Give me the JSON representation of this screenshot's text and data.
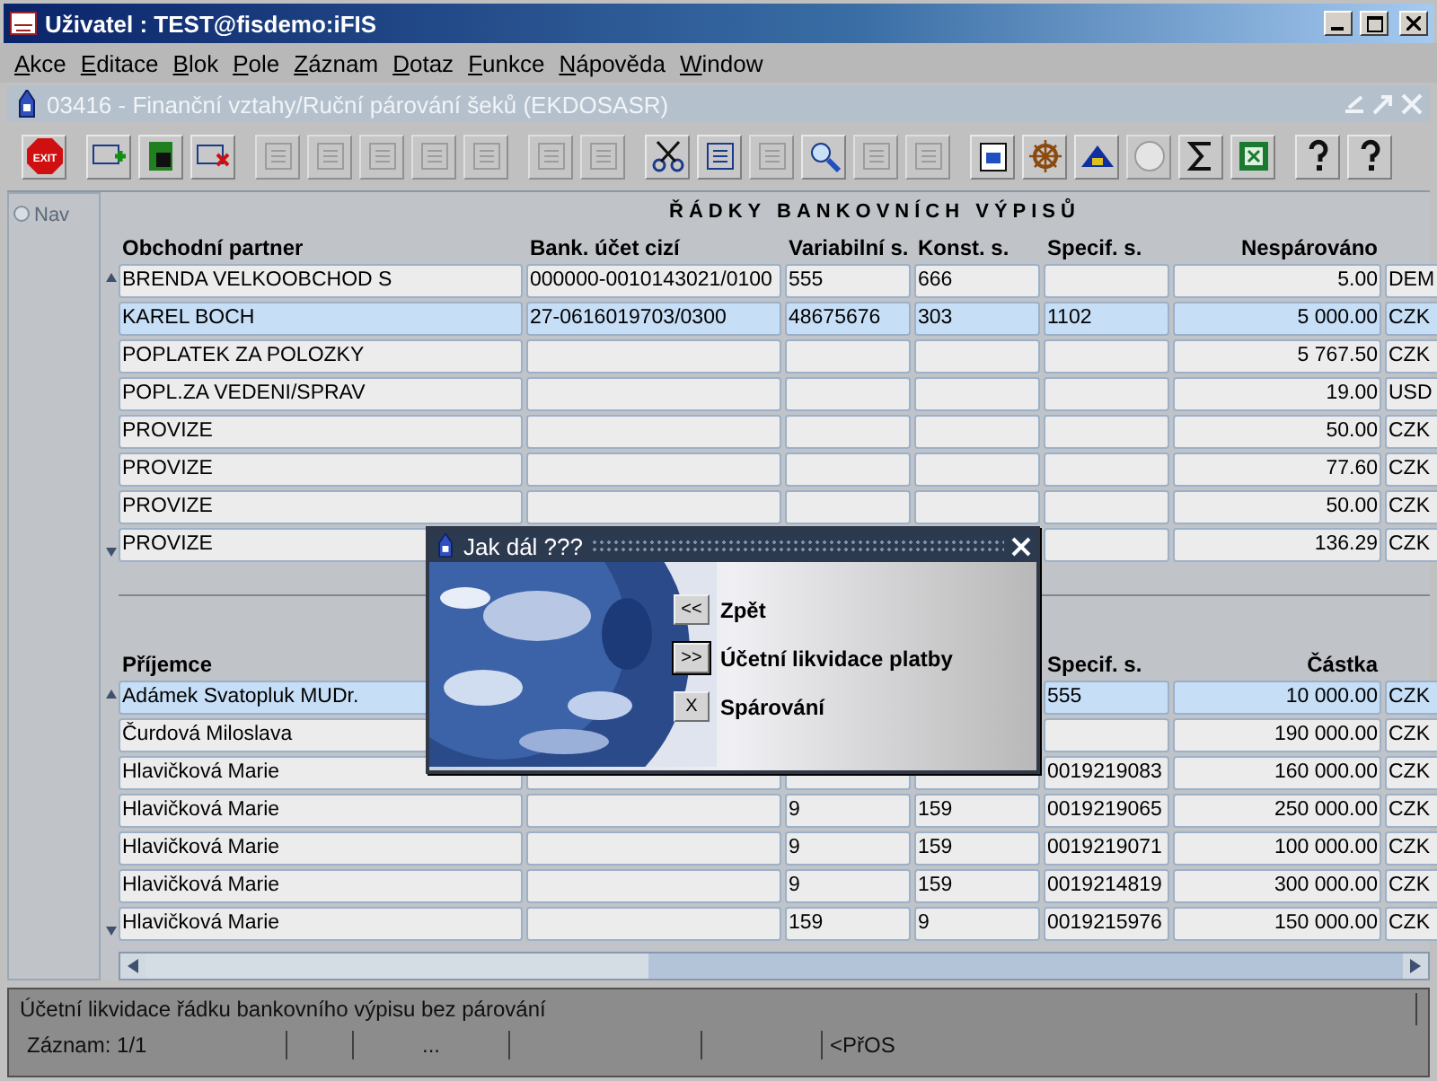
{
  "window": {
    "title": "Uživatel : TEST@fisdemo:iFIS"
  },
  "menu": [
    "Akce",
    "Editace",
    "Blok",
    "Pole",
    "Záznam",
    "Dotaz",
    "Funkce",
    "Nápověda",
    "Window"
  ],
  "form": {
    "title": "03416 - Finanční vztahy/Ruční párování šeků (EKDOSASR)"
  },
  "toolbar": [
    {
      "label": "EXIT",
      "disabled": false
    },
    {
      "disabled": false
    },
    {
      "disabled": false
    },
    {
      "disabled": false
    },
    {
      "disabled": true
    },
    {
      "disabled": true
    },
    {
      "disabled": true
    },
    {
      "disabled": true
    },
    {
      "disabled": true
    },
    {
      "disabled": true
    },
    {
      "disabled": true
    },
    {
      "disabled": false
    },
    {
      "disabled": false
    },
    {
      "disabled": true
    },
    {
      "disabled": false
    },
    {
      "disabled": true
    },
    {
      "disabled": true
    },
    {
      "disabled": false
    },
    {
      "disabled": false
    },
    {
      "disabled": false
    },
    {
      "disabled": true
    },
    {
      "disabled": false
    },
    {
      "disabled": false
    },
    {
      "disabled": false
    },
    {
      "disabled": false
    }
  ],
  "nav": {
    "label": "Nav"
  },
  "bank_lines": {
    "title": "ŘÁDKY BANKOVNÍCH VÝPISŮ",
    "columns": {
      "partner": "Obchodní partner",
      "account": "Bank. účet cizí",
      "var": "Variabilní s.",
      "const": "Konst. s.",
      "spec": "Specif. s.",
      "amount": "Nespárováno"
    },
    "rows": [
      {
        "partner": "BRENDA VELKOOBCHOD S",
        "account": "000000-0010143021/0100",
        "var": "555",
        "const": "666",
        "amount": "5.00",
        "currency": "DEM",
        "selected": false
      },
      {
        "partner": "KAREL BOCH",
        "account": "27-0616019703/0300",
        "var": "48675676",
        "const": "303",
        "spec": "1102",
        "amount": "5 000.00",
        "currency": "CZK",
        "selected": true
      },
      {
        "partner": "POPLATEK ZA POLOZKY",
        "amount": "5 767.50",
        "currency": "CZK",
        "selected": false
      },
      {
        "partner": "POPL.ZA VEDENI/SPRAV",
        "amount": "19.00",
        "currency": "USD",
        "selected": false
      },
      {
        "partner": "PROVIZE",
        "amount": "50.00",
        "currency": "CZK",
        "selected": false
      },
      {
        "partner": "PROVIZE",
        "amount": "77.60",
        "currency": "CZK",
        "selected": false
      },
      {
        "partner": "PROVIZE",
        "amount": "50.00",
        "currency": "CZK",
        "selected": false
      },
      {
        "partner": "PROVIZE",
        "amount": "136.29",
        "currency": "CZK",
        "selected": false
      }
    ]
  },
  "payments": {
    "columns": {
      "partner": "Příjemce",
      "spec": "Specif. s.",
      "amount": "Částka"
    },
    "rows": [
      {
        "partner": "Adámek Svatopluk MUDr.",
        "spec": "555",
        "amount": "10 000.00",
        "currency": "CZK",
        "selected": true
      },
      {
        "partner": "Čurdová Miloslava",
        "amount": "190 000.00",
        "currency": "CZK",
        "selected": false
      },
      {
        "partner": "Hlavičková Marie",
        "spec": "0019219083",
        "amount": "160 000.00",
        "currency": "CZK",
        "selected": false
      },
      {
        "partner": "Hlavičková Marie",
        "var": "9",
        "const": "159",
        "spec": "0019219065",
        "amount": "250 000.00",
        "currency": "CZK",
        "selected": false
      },
      {
        "partner": "Hlavičková Marie",
        "var": "9",
        "const": "159",
        "spec": "0019219071",
        "amount": "100 000.00",
        "currency": "CZK",
        "selected": false
      },
      {
        "partner": "Hlavičková Marie",
        "var": "9",
        "const": "159",
        "spec": "0019214819",
        "amount": "300 000.00",
        "currency": "CZK",
        "selected": false
      },
      {
        "partner": "Hlavičková Marie",
        "var": "159",
        "const": "9",
        "spec": "0019215976",
        "amount": "150 000.00",
        "currency": "CZK",
        "selected": false
      }
    ]
  },
  "dialog": {
    "title": "Jak dál ???",
    "options": [
      {
        "key": "<<",
        "label": "Zpět",
        "focused": false
      },
      {
        "key": ">>",
        "label": "Účetní likvidace platby",
        "focused": true
      },
      {
        "key": "X",
        "label": "Spárování",
        "focused": false
      }
    ]
  },
  "status_bar": {
    "message": "Účetní likvidace řádku bankovního výpisu bez párování",
    "fields": [
      "Záznam: 1/1",
      "...",
      "<PřOS"
    ]
  }
}
